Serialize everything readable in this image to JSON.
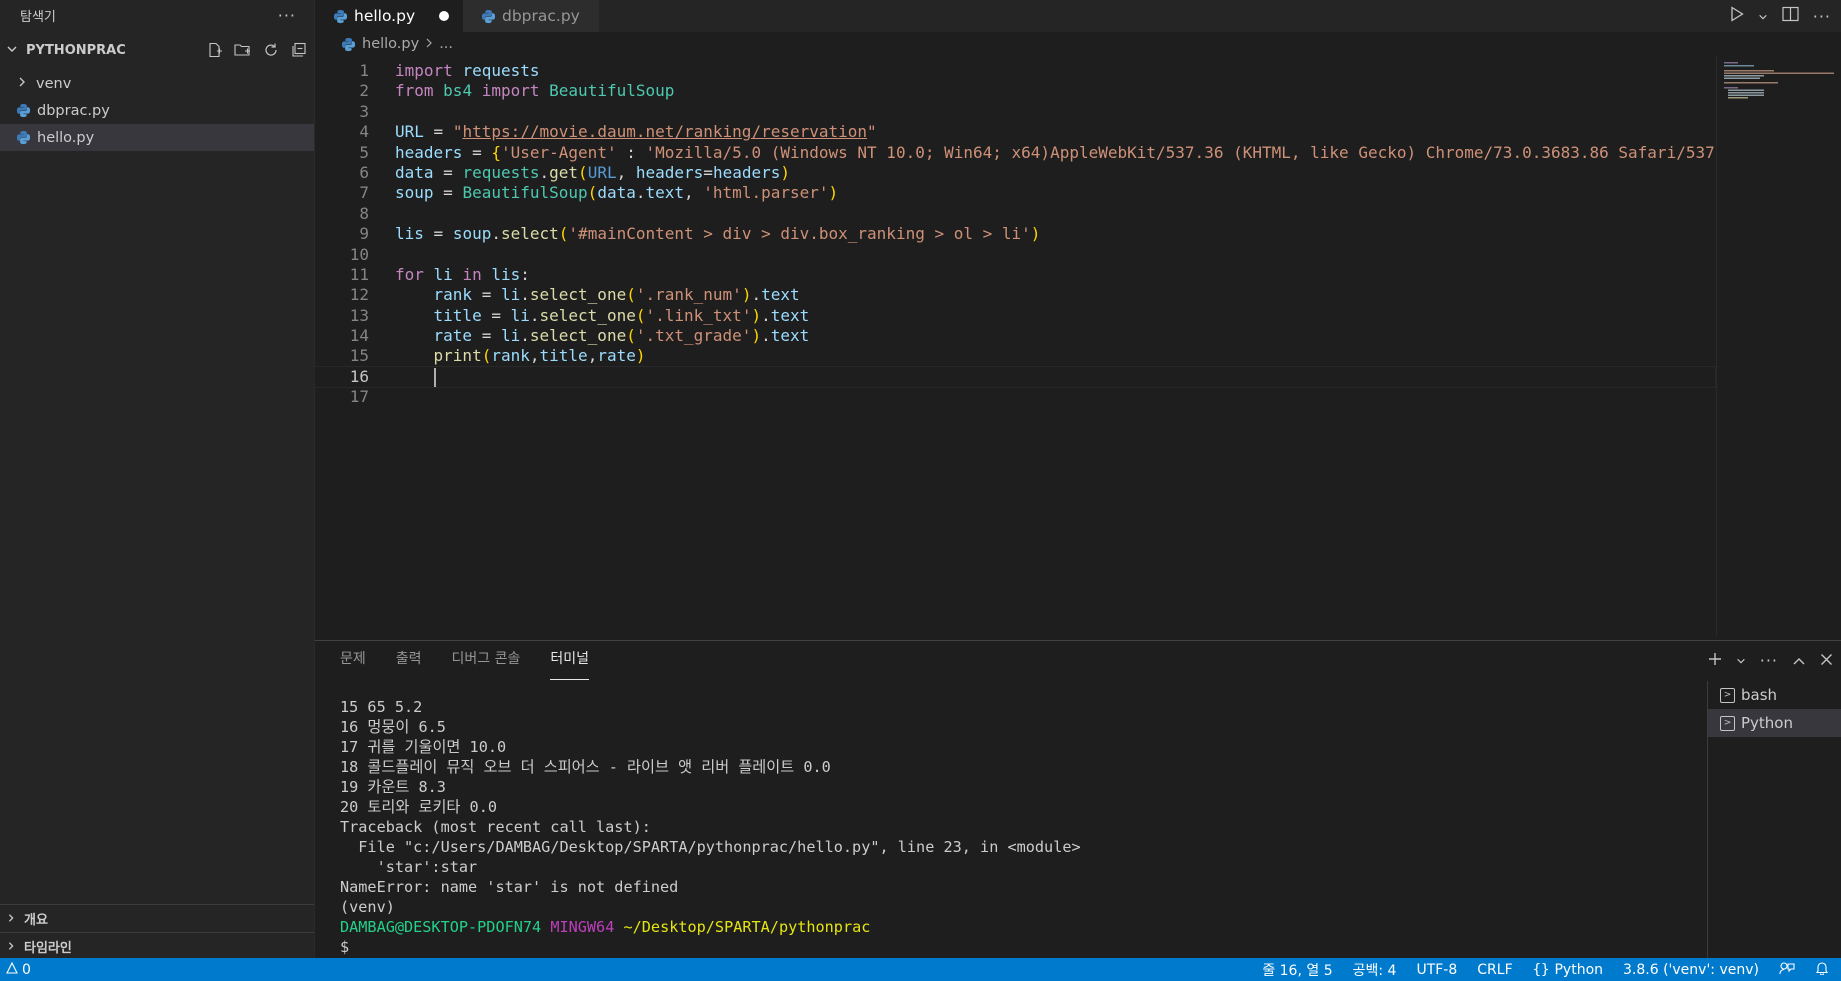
{
  "sidebar": {
    "title": "탐색기",
    "more": "···",
    "project": "PYTHONPRAC",
    "items": [
      {
        "label": "venv",
        "type": "folder"
      },
      {
        "label": "dbprac.py",
        "type": "python"
      },
      {
        "label": "hello.py",
        "type": "python"
      }
    ],
    "sections": [
      {
        "label": "개요"
      },
      {
        "label": "타임라인"
      }
    ]
  },
  "tabs": [
    {
      "label": "hello.py",
      "dirty": true,
      "active": true
    },
    {
      "label": "dbprac.py",
      "active": false
    }
  ],
  "breadcrumb": {
    "file": "hello.py",
    "rest": "..."
  },
  "editor": {
    "line_numbers": [
      "1",
      "2",
      "3",
      "4",
      "5",
      "6",
      "7",
      "8",
      "9",
      "10",
      "11",
      "12",
      "13",
      "14",
      "15",
      "16",
      "17"
    ],
    "current_line": "16",
    "code": {
      "l1a": "import",
      "l1b": "requests",
      "l2a": "from",
      "l2b": "bs4",
      "l2c": "import",
      "l2d": "BeautifulSoup",
      "l4a": "URL",
      "l4b": " = ",
      "l4c": "\"",
      "l4d": "https://movie.daum.net/ranking/reservation",
      "l4e": "\"",
      "l5a": "headers",
      "l5b": " = ",
      "l5c": "{",
      "l5d": "'User-Agent'",
      "l5e": " : ",
      "l5f": "'Mozilla/5.0 (Windows NT 10.0; Win64; x64)AppleWebKit/537.36 (KHTML, like Gecko) Chrome/73.0.3683.86 Safari/537",
      "l6a": "data",
      "l6b": " = ",
      "l6c": "requests",
      "l6d": ".",
      "l6e": "get",
      "l6f": "(",
      "l6g": "URL",
      "l6h": ", ",
      "l6i": "headers",
      "l6j": "=",
      "l6k": "headers",
      "l6l": ")",
      "l7a": "soup",
      "l7b": " = ",
      "l7c": "BeautifulSoup",
      "l7d": "(",
      "l7e": "data",
      "l7f": ".",
      "l7g": "text",
      "l7h": ", ",
      "l7i": "'html.parser'",
      "l7j": ")",
      "l9a": "lis",
      "l9b": " = ",
      "l9c": "soup",
      "l9d": ".",
      "l9e": "select",
      "l9f": "(",
      "l9g": "'#mainContent > div > div.box_ranking > ol > li'",
      "l9h": ")",
      "l11a": "for",
      "l11b": "li",
      "l11c": "in",
      "l11d": "lis",
      "l11e": ":",
      "l12a": "rank",
      "l12b": " = ",
      "l12c": "li",
      "l12d": ".",
      "l12e": "select_one",
      "l12f": "(",
      "l12g": "'.rank_num'",
      "l12h": ")",
      "l12i": ".",
      "l12j": "text",
      "l13a": "title",
      "l13b": " = ",
      "l13c": "li",
      "l13d": ".",
      "l13e": "select_one",
      "l13f": "(",
      "l13g": "'.link_txt'",
      "l13h": ")",
      "l13i": ".",
      "l13j": "text",
      "l14a": "rate",
      "l14b": " = ",
      "l14c": "li",
      "l14d": ".",
      "l14e": "select_one",
      "l14f": "(",
      "l14g": "'.txt_grade'",
      "l14h": ")",
      "l14i": ".",
      "l14j": "text",
      "l15a": "print",
      "l15b": "(",
      "l15c": "rank",
      "l15d": ",",
      "l15e": "title",
      "l15f": ",",
      "l15g": "rate",
      "l15h": ")"
    }
  },
  "panel": {
    "tabs": [
      "문제",
      "출력",
      "디버그 콘솔",
      "터미널"
    ],
    "active_tab": "터미널",
    "terminal_lines": [
      "15 65 5.2",
      "16 멍뭉이 6.5",
      "17 귀를 기울이면 10.0",
      "18 콜드플레이 뮤직 오브 더 스피어스 - 라이브 앳 리버 플레이트 0.0",
      "19 카운트 8.3",
      "20 토리와 로키타 0.0",
      "Traceback (most recent call last):",
      "  File \"c:/Users/DAMBAG/Desktop/SPARTA/pythonprac/hello.py\", line 23, in <module>",
      "    'star':star",
      "NameError: name 'star' is not defined",
      "(venv) "
    ],
    "prompt": {
      "user": "DAMBAG@DESKTOP-PDOFN74",
      "shell": "MINGW64",
      "path": "~/Desktop/SPARTA/pythonprac",
      "symbol": "$"
    },
    "terminals": [
      {
        "label": "bash"
      },
      {
        "label": "Python"
      }
    ]
  },
  "statusbar": {
    "errors": "0",
    "position": "줄 16, 열 5",
    "spaces": "공백: 4",
    "encoding": "UTF-8",
    "eol": "CRLF",
    "language": "Python",
    "interpreter": "3.8.6 ('venv': venv)"
  },
  "colors": {
    "accent": "#007acc",
    "editor_bg": "#1e1e1e",
    "sidebar_bg": "#252526"
  }
}
